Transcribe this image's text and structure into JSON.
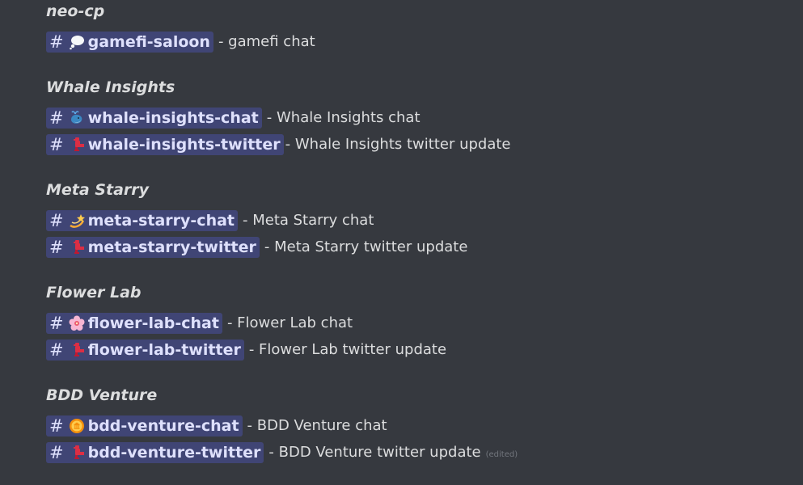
{
  "sections": [
    {
      "title": "neo-cp",
      "channels": [
        {
          "emoji": "speech-bubble-icon",
          "name": "gamefi-saloon",
          "desc": "- gamefi chat"
        }
      ]
    },
    {
      "title": "Whale Insights",
      "channels": [
        {
          "emoji": "whale-icon",
          "name": "whale-insights-chat",
          "desc": "- Whale Insights chat"
        },
        {
          "emoji": "red-bird-icon",
          "name": "whale-insights-twitter",
          "desc": "-  Whale Insights twitter update"
        }
      ]
    },
    {
      "title": "Meta Starry",
      "channels": [
        {
          "emoji": "dizzy-star-icon",
          "name": "meta-starry-chat",
          "desc": "- Meta Starry chat"
        },
        {
          "emoji": "red-bird-icon",
          "name": "meta-starry-twitter",
          "desc": "- Meta Starry twitter update"
        }
      ]
    },
    {
      "title": "Flower Lab",
      "channels": [
        {
          "emoji": "cherry-blossom-icon",
          "name": "flower-lab-chat",
          "desc": "- Flower Lab chat"
        },
        {
          "emoji": "red-bird-icon",
          "name": "flower-lab-twitter",
          "desc": "- Flower Lab twitter update"
        }
      ]
    },
    {
      "title": "BDD Venture",
      "channels": [
        {
          "emoji": "gold-coin-icon",
          "name": "bdd-venture-chat",
          "desc": "- BDD Venture chat"
        },
        {
          "emoji": "red-bird-icon",
          "name": "bdd-venture-twitter",
          "desc": "- BDD Venture twitter update"
        }
      ]
    }
  ],
  "hash_symbol": "#",
  "edited_label": "(edited)",
  "colors": {
    "background": "#36393f",
    "text": "#dcddde",
    "mention_bg": "rgba(88,101,242,0.3)",
    "mention_text": "#dee0fc",
    "muted": "#72767d"
  }
}
